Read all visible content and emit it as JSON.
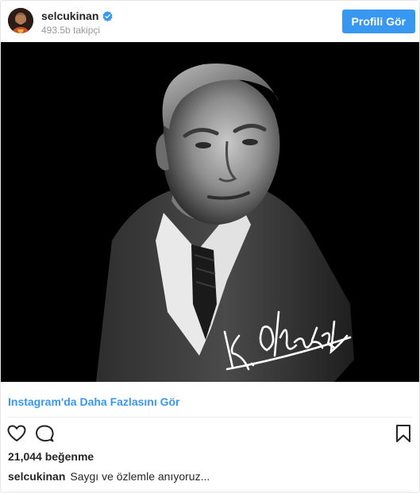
{
  "header": {
    "username": "selcukinan",
    "followers": "493.5b takipçi",
    "profile_button": "Profili Gör",
    "verified_icon": "verified-badge-icon"
  },
  "post": {
    "image_icon": "portrait-photo",
    "more_link": "Instagram'da Daha Fazlasını Gör",
    "likes": "21,044 beğenme",
    "caption_user": "selcukinan",
    "caption_text": "Saygı ve özlemle anıyoruz..."
  },
  "icons": {
    "like": "heart-icon",
    "comment": "comment-icon",
    "save": "bookmark-icon"
  },
  "colors": {
    "accent": "#3897f0",
    "text": "#262626",
    "muted": "#999999",
    "divider": "#efefef"
  }
}
